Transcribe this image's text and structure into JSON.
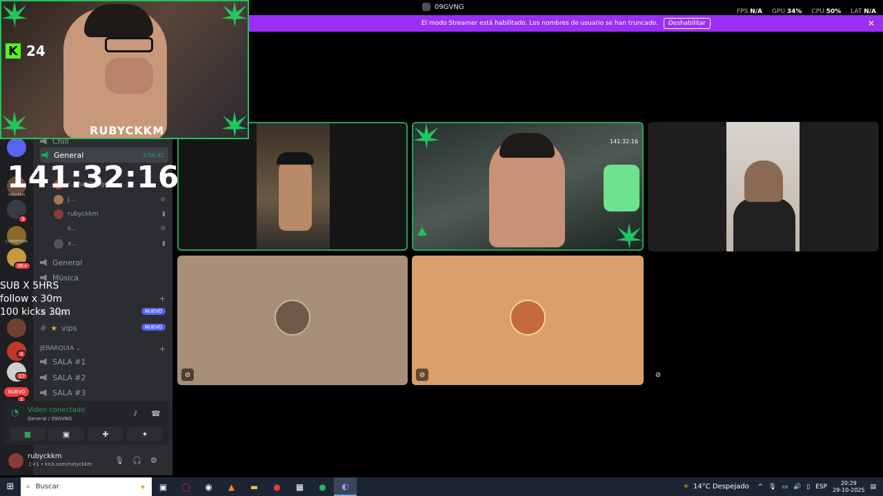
{
  "window": {
    "title": "09GVNG",
    "stats": [
      {
        "label": "FPS",
        "value": "N/A"
      },
      {
        "label": "GPU",
        "value": "34%"
      },
      {
        "label": "CPU",
        "value": "50%"
      },
      {
        "label": "LAT",
        "value": "N/A"
      }
    ]
  },
  "banner": {
    "text": "El modo Streamer está habilitado. Los nombres de usuario se han truncado.",
    "button": "Deshabilitar",
    "close": "✕"
  },
  "overlay": {
    "viewers": "24",
    "kick_logo": "K",
    "streamer_name": "RUBYCKKM",
    "timer": "141:32:16",
    "goals": [
      "SUB X 5HRS",
      "follow x 30m",
      "100 kicks 30m"
    ]
  },
  "rail": {
    "badges": [
      "3",
      "3K+",
      "4",
      "17",
      "1"
    ],
    "labels": [
      "rubyckkm",
      "CORNEPISTA"
    ],
    "nuevo": "NUEVO"
  },
  "channels": {
    "top_partial": "Chill",
    "active_channel": "General",
    "active_time": "5:56:42",
    "members": [
      {
        "name": "r... hablologo"
      },
      {
        "name": "j..."
      },
      {
        "name": "rubyckkm"
      },
      {
        "name": "s..."
      },
      {
        "name": "x..."
      }
    ],
    "voice_channels": [
      {
        "name": "General"
      },
      {
        "name": "Música"
      }
    ],
    "text_category": "",
    "text_channels": [
      {
        "name": "clips",
        "badge": "NUEVO"
      },
      {
        "name": "vips",
        "badge": "NUEVO"
      }
    ],
    "category2": "JERARQUIA",
    "salas": [
      "SALA #1",
      "SALA #2",
      "SALA #3"
    ]
  },
  "voice_panel": {
    "status": "Video conectado",
    "location": "General / 09GVNG"
  },
  "user": {
    "name": "rubyckkm",
    "status": "♫+1 • kick.com/rubyckkm"
  },
  "grid": {
    "tile2_time": "141:32:16"
  },
  "taskbar": {
    "search_placeholder": "Buscar",
    "weather": "14°C  Despejado",
    "language": "ESP",
    "time": "20:29",
    "date": "29-10-2025"
  }
}
